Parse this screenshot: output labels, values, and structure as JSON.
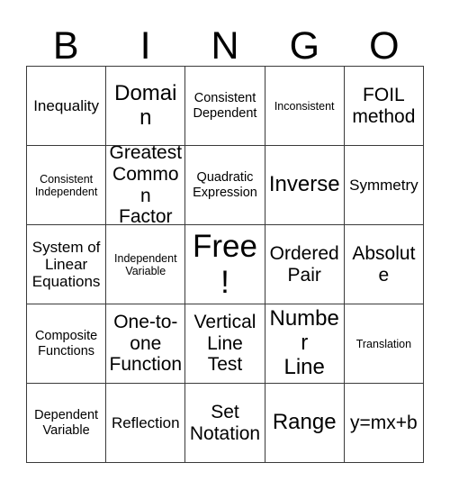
{
  "card": {
    "header_letters": [
      "B",
      "I",
      "N",
      "G",
      "O"
    ],
    "border_color": "#3a3a3a",
    "text_color": "#000000",
    "background_color": "#ffffff",
    "rows": 5,
    "columns": 5,
    "cells": [
      [
        {
          "label": "Inequality",
          "size": "md",
          "lines": [
            "Inequality"
          ]
        },
        {
          "label": "Domain",
          "size": "xl",
          "lines": [
            "Domain"
          ]
        },
        {
          "label": "Consistent Dependent",
          "size": "sm",
          "lines": [
            "Consistent",
            "Dependent"
          ]
        },
        {
          "label": "Inconsistent",
          "size": "xs",
          "lines": [
            "Inconsistent"
          ]
        },
        {
          "label": "FOIL method",
          "size": "lg",
          "lines": [
            "FOIL",
            "method"
          ]
        }
      ],
      [
        {
          "label": "Consistent Independent",
          "size": "xs",
          "lines": [
            "Consistent",
            "Independent"
          ]
        },
        {
          "label": "Greatest Common Factor",
          "size": "lg",
          "lines": [
            "Greatest",
            "Common",
            "Factor"
          ]
        },
        {
          "label": "Quadratic Expression",
          "size": "sm",
          "lines": [
            "Quadratic",
            "Expression"
          ]
        },
        {
          "label": "Inverse",
          "size": "xl",
          "lines": [
            "Inverse"
          ]
        },
        {
          "label": "Symmetry",
          "size": "md",
          "lines": [
            "Symmetry"
          ]
        }
      ],
      [
        {
          "label": "System of Linear Equations",
          "size": "md",
          "lines": [
            "System of",
            "Linear",
            "Equations"
          ]
        },
        {
          "label": "Independent Variable",
          "size": "xs",
          "lines": [
            "Independent",
            "Variable"
          ]
        },
        {
          "label": "Free!",
          "size": "xxl",
          "lines": [
            "Free!"
          ]
        },
        {
          "label": "Ordered Pair",
          "size": "lg",
          "lines": [
            "Ordered",
            "Pair"
          ]
        },
        {
          "label": "Absolute",
          "size": "lg",
          "lines": [
            "Absolute"
          ]
        }
      ],
      [
        {
          "label": "Composite Functions",
          "size": "sm",
          "lines": [
            "Composite",
            "Functions"
          ]
        },
        {
          "label": "One-to-one Function",
          "size": "lg",
          "lines": [
            "One-to-",
            "one",
            "Function"
          ]
        },
        {
          "label": "Vertical Line Test",
          "size": "lg",
          "lines": [
            "Vertical",
            "Line",
            "Test"
          ]
        },
        {
          "label": "Number Line",
          "size": "xl",
          "lines": [
            "Number",
            "Line"
          ]
        },
        {
          "label": "Translation",
          "size": "xs",
          "lines": [
            "Translation"
          ]
        }
      ],
      [
        {
          "label": "Dependent Variable",
          "size": "sm",
          "lines": [
            "Dependent",
            "Variable"
          ]
        },
        {
          "label": "Reflection",
          "size": "md",
          "lines": [
            "Reflection"
          ]
        },
        {
          "label": "Set Notation",
          "size": "lg",
          "lines": [
            "Set",
            "Notation"
          ]
        },
        {
          "label": "Range",
          "size": "xl",
          "lines": [
            "Range"
          ]
        },
        {
          "label": "y=mx+b",
          "size": "lg",
          "lines": [
            "y=mx+b"
          ]
        }
      ]
    ]
  }
}
